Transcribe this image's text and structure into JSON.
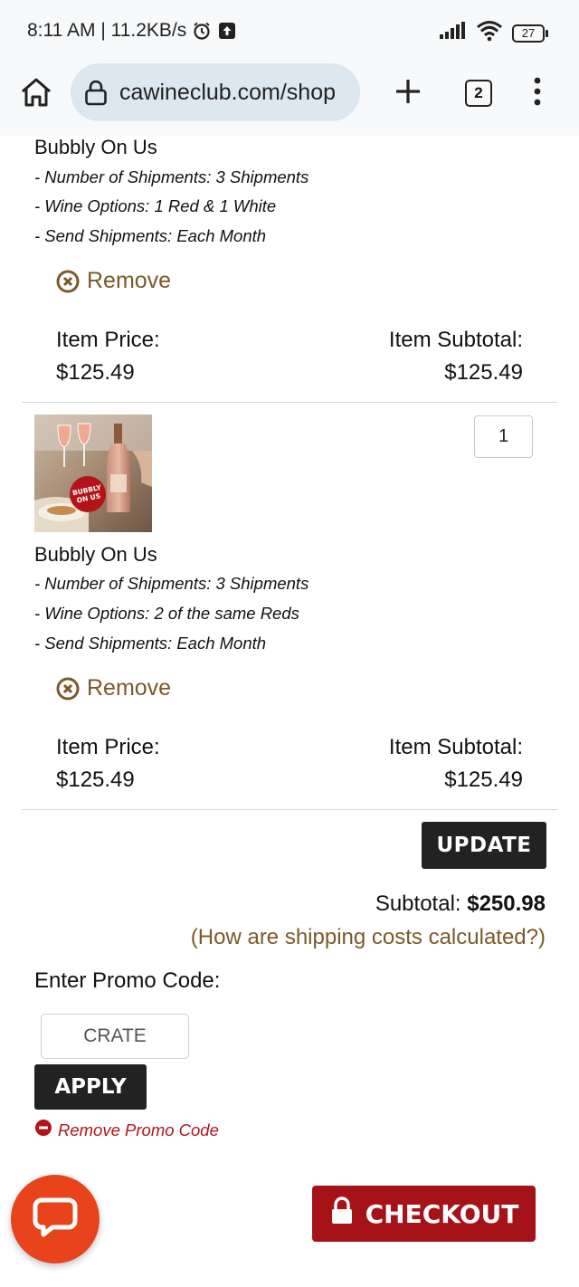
{
  "status_bar": {
    "time_speed": "8:11 AM | 11.2KB/s",
    "battery": "27",
    "icons": [
      "alarm-icon",
      "upload-icon",
      "signal-icon",
      "wifi-icon",
      "battery-icon"
    ]
  },
  "browser": {
    "url": "cawineclub.com/shop",
    "tab_count": "2",
    "icons": [
      "home-icon",
      "lock-icon",
      "plus-icon",
      "more-vert-icon"
    ]
  },
  "cart": {
    "items": [
      {
        "title": "Bubbly On Us",
        "options": [
          "- Number of Shipments: 3 Shipments",
          "- Wine Options: 1 Red & 1 White",
          "- Send Shipments: Each Month"
        ],
        "remove_label": "Remove",
        "price_label": "Item Price:",
        "price": "$125.49",
        "subtotal_label": "Item Subtotal:",
        "subtotal": "$125.49"
      },
      {
        "title": "Bubbly On Us",
        "quantity": "1",
        "badge_text": "BUBBLY ON US",
        "options": [
          "- Number of Shipments: 3 Shipments",
          "- Wine Options: 2 of the same Reds",
          "- Send Shipments: Each Month"
        ],
        "remove_label": "Remove",
        "price_label": "Item Price:",
        "price": "$125.49",
        "subtotal_label": "Item Subtotal:",
        "subtotal": "$125.49"
      }
    ],
    "update_label": "UPDATE",
    "subtotal_label": "Subtotal:",
    "subtotal_value": "$250.98",
    "shipping_link": "(How are shipping costs calculated?)",
    "promo_label": "Enter Promo Code:",
    "promo_value": "CRATE",
    "apply_label": "APPLY",
    "remove_promo_label": "Remove Promo Code",
    "checkout_label": "CHECKOUT"
  },
  "colors": {
    "accent_brown": "#7a5a2a",
    "checkout_red": "#a51217",
    "chat_orange": "#e8431a",
    "dark_button": "#222222",
    "url_pill": "#dde7f0"
  }
}
